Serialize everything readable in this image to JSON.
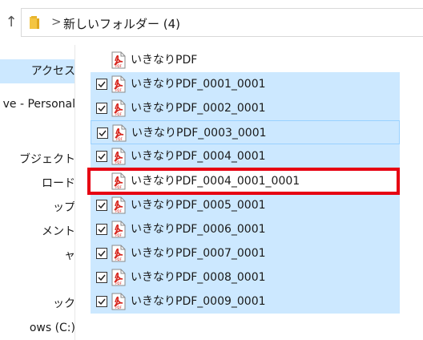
{
  "address_bar": {
    "up_icon": "up-arrow-icon",
    "folder_icon": "folder-icon",
    "chevron": ">",
    "path": "新しいフォルダー (4)"
  },
  "nav": {
    "items": [
      {
        "label": "アクセス",
        "selected": true
      },
      {
        "label": "ve - Personal",
        "selected": false
      },
      {
        "label": "ブジェクト",
        "selected": false
      },
      {
        "label": "ロード",
        "selected": false
      },
      {
        "label": "ップ",
        "selected": false
      },
      {
        "label": "メント",
        "selected": false
      },
      {
        "label": "ャ",
        "selected": false
      },
      {
        "label": "ック",
        "selected": false
      },
      {
        "label": "ows (C:)",
        "selected": false
      }
    ]
  },
  "files": [
    {
      "name": "いきなりPDF",
      "checked": false,
      "selected": false
    },
    {
      "name": "いきなりPDF_0001_0001",
      "checked": true,
      "selected": true
    },
    {
      "name": "いきなりPDF_0002_0001",
      "checked": true,
      "selected": true
    },
    {
      "name": "いきなりPDF_0003_0001",
      "checked": true,
      "selected": true
    },
    {
      "name": "いきなりPDF_0004_0001",
      "checked": true,
      "selected": true
    },
    {
      "name": "いきなりPDF_0004_0001_0001",
      "checked": false,
      "selected": false
    },
    {
      "name": "いきなりPDF_0005_0001",
      "checked": true,
      "selected": true
    },
    {
      "name": "いきなりPDF_0006_0001",
      "checked": true,
      "selected": true
    },
    {
      "name": "いきなりPDF_0007_0001",
      "checked": true,
      "selected": true
    },
    {
      "name": "いきなりPDF_0008_0001",
      "checked": true,
      "selected": true
    },
    {
      "name": "いきなりPDF_0009_0001",
      "checked": true,
      "selected": true
    }
  ],
  "colors": {
    "selection": "#cce8ff",
    "highlight_border": "#e60012",
    "pdf_red": "#d7261e"
  }
}
